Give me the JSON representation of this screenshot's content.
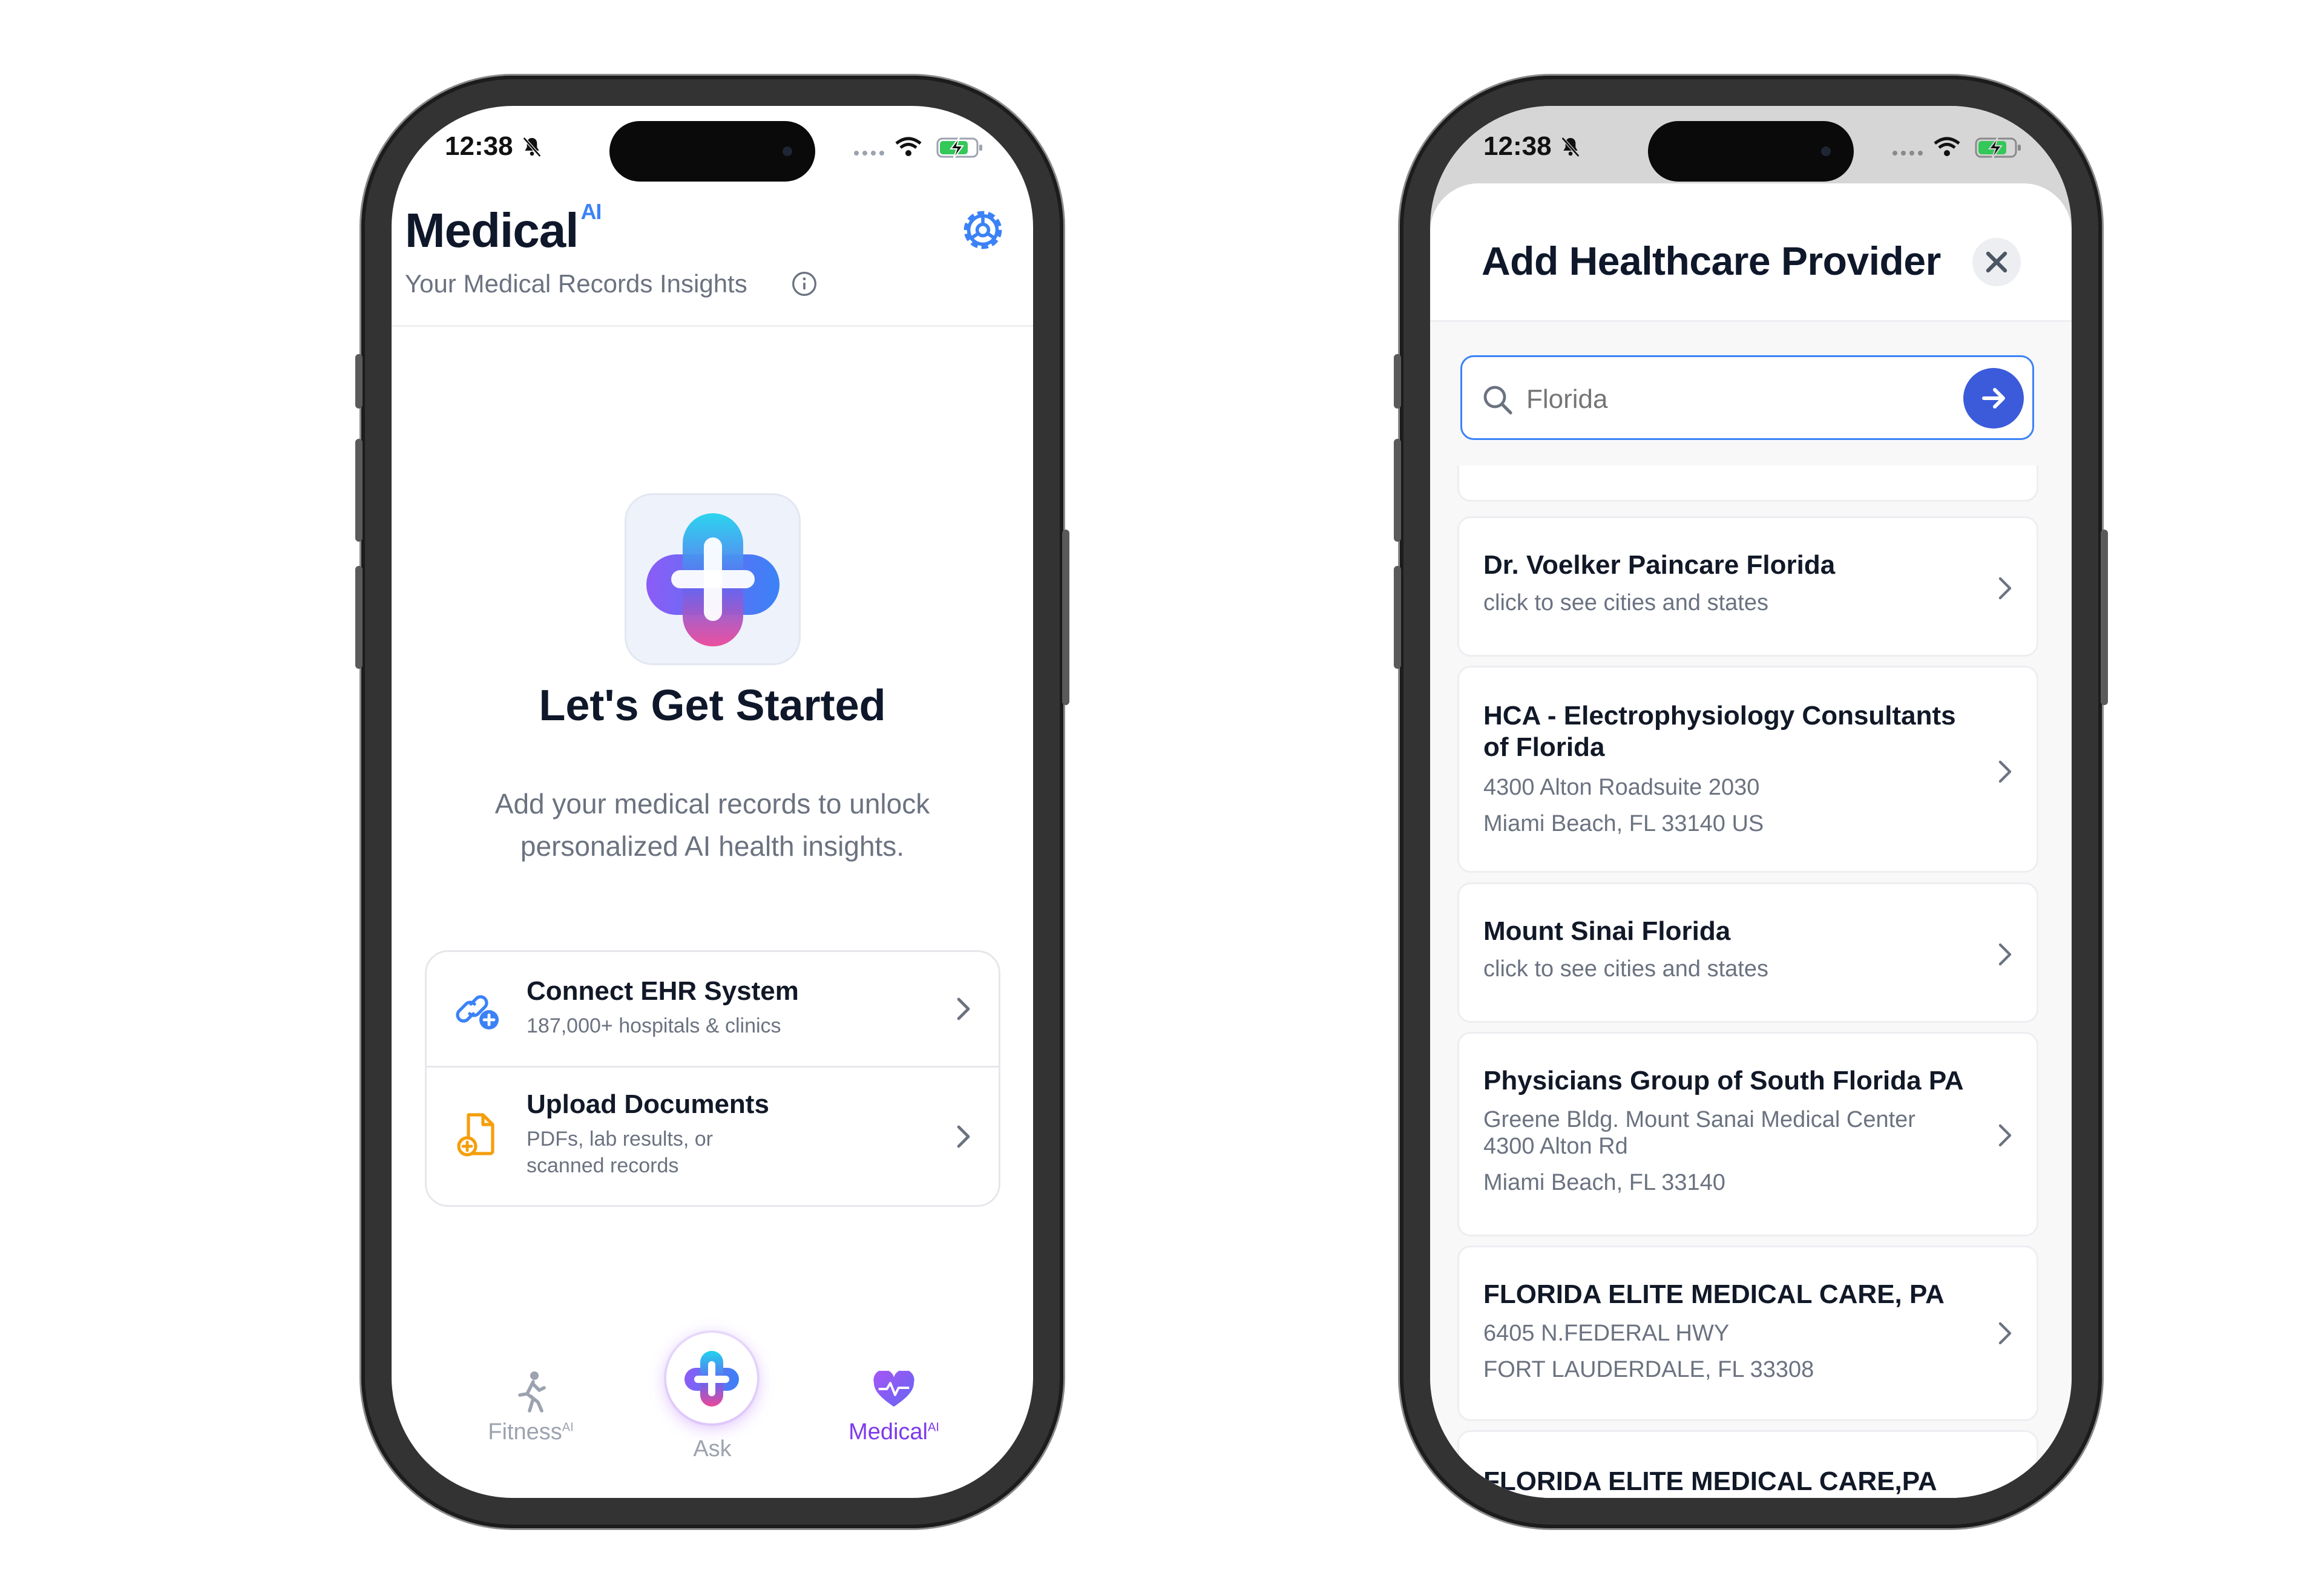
{
  "status": {
    "time": "12:38"
  },
  "medical_screen": {
    "app_title": "Medical",
    "app_title_badge": "AI",
    "subtitle": "Your Medical Records Insights",
    "hero_title": "Let's Get Started",
    "hero_body": "Add your medical records to unlock personalized AI health insights.",
    "options": [
      {
        "title": "Connect EHR System",
        "subtitle": "187,000+ hospitals & clinics",
        "icon": "link-plus-icon"
      },
      {
        "title": "Upload Documents",
        "subtitle_line1": "PDFs, lab results, or",
        "subtitle_line2": "scanned records",
        "icon": "document-plus-icon"
      }
    ],
    "tabbar": {
      "fitness_label": "Fitness",
      "fitness_badge": "AI",
      "ask_label": "Ask",
      "medical_label": "Medical",
      "medical_badge": "AI",
      "active": "medical"
    }
  },
  "provider_screen": {
    "sheet_title": "Add Healthcare Provider",
    "search": {
      "value": "",
      "placeholder": "Florida"
    },
    "results": [
      {
        "title": "Dr. Voelker Paincare Florida",
        "lines": [
          "click to see cities and states"
        ]
      },
      {
        "title_line1": "HCA - Electrophysiology Consultants",
        "title_line2": "of Florida",
        "lines": [
          "4300 Alton Roadsuite 2030",
          "Miami Beach, FL 33140 US"
        ]
      },
      {
        "title": "Mount Sinai Florida",
        "lines": [
          "click to see cities and states"
        ]
      },
      {
        "title": "Physicians Group of South Florida PA",
        "lines": [
          "Greene Bldg. Mount Sanai Medical Center",
          "4300 Alton Rd",
          "Miami Beach, FL 33140"
        ]
      },
      {
        "title": "FLORIDA ELITE MEDICAL CARE, PA",
        "lines": [
          "6405 N.FEDERAL HWY",
          "FORT LAUDERDALE, FL 33308"
        ]
      },
      {
        "title": "FLORIDA ELITE MEDICAL CARE,PA",
        "lines": []
      }
    ]
  },
  "colors": {
    "accent_blue": "#3b82f6",
    "brand_purple": "#7c3aed",
    "search_button": "#3b5bdb",
    "upload_orange": "#f59e0b"
  }
}
